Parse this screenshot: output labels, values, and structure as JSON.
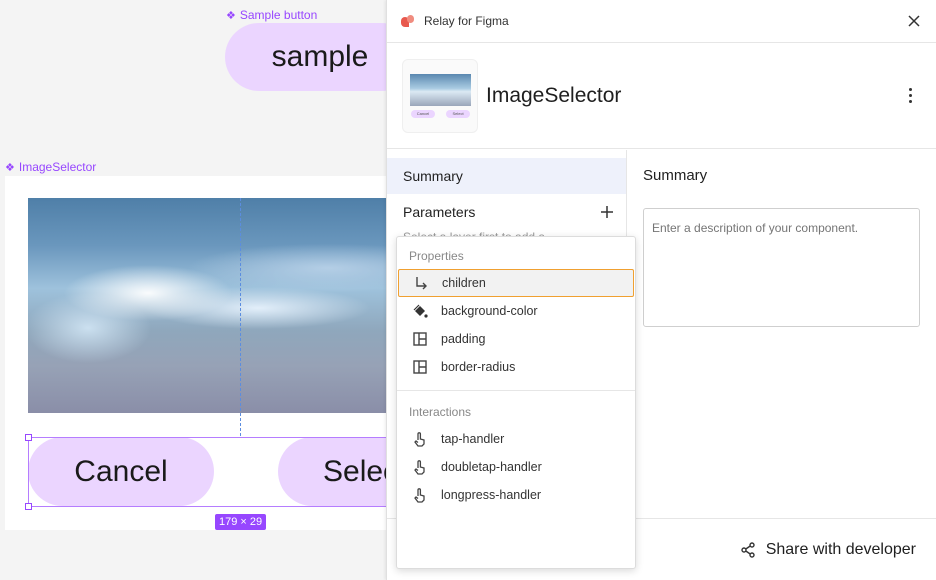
{
  "canvas": {
    "sample_label": "Sample button",
    "sample_button_text": "sample",
    "frame_label": "ImageSelector",
    "cancel_text": "Cancel",
    "select_text": "Select",
    "size_badge": "179 × 29"
  },
  "panel": {
    "app_title": "Relay for Figma",
    "component_name": "ImageSelector",
    "thumb_cancel": "Cancel",
    "thumb_select": "Select",
    "nav": {
      "summary": "Summary",
      "parameters": "Parameters",
      "hint": "Select a layer first to add a"
    },
    "summary_title": "Summary",
    "description_placeholder": "Enter a description of your component.",
    "share_label": "Share with developer"
  },
  "menu": {
    "properties_label": "Properties",
    "properties": [
      {
        "label": "children",
        "icon": "child-arrow-icon"
      },
      {
        "label": "background-color",
        "icon": "paint-bucket-icon"
      },
      {
        "label": "padding",
        "icon": "layout-icon"
      },
      {
        "label": "border-radius",
        "icon": "layout-icon"
      }
    ],
    "interactions_label": "Interactions",
    "interactions": [
      {
        "label": "tap-handler",
        "icon": "touch-icon"
      },
      {
        "label": "doubletap-handler",
        "icon": "touch-icon"
      },
      {
        "label": "longpress-handler",
        "icon": "touch-icon"
      }
    ]
  },
  "colors": {
    "accent_purple": "#9747ff",
    "pill_fill": "#ebd5ff",
    "menu_focus": "#f0a030",
    "relay_logo": "#e8594e"
  }
}
